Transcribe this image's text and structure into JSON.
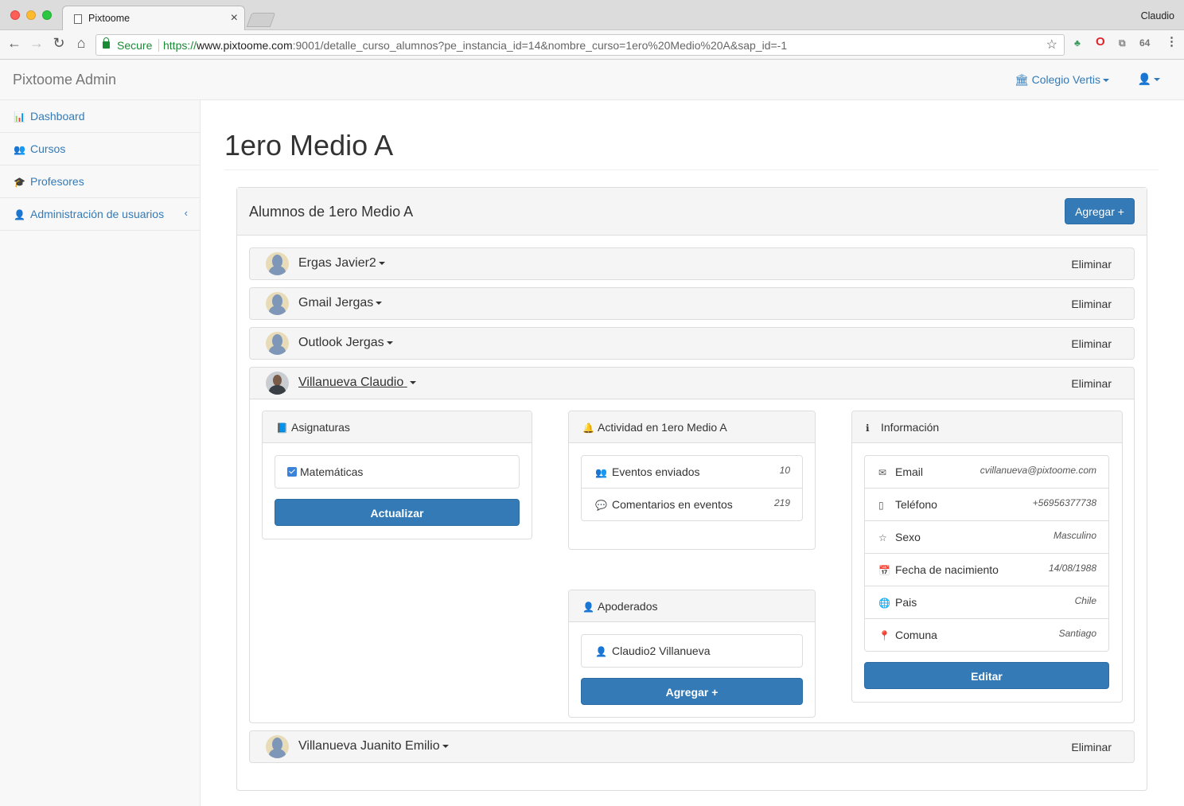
{
  "browser": {
    "tab_title": "Pixtoome",
    "user": "Claudio",
    "secure_label": "Secure",
    "url_scheme": "https://",
    "url_host": "www.pixtoome.com",
    "url_rest": ":9001/detalle_curso_alumnos?pe_instancia_id=14&nombre_curso=1ero%20Medio%20A&sap_id=-1",
    "extension_badge": "64"
  },
  "navbar": {
    "brand": "Pixtoome Admin",
    "school": "Colegio Vertis"
  },
  "sidebar": {
    "items": [
      {
        "label": "Dashboard",
        "icon": "bar-chart-icon"
      },
      {
        "label": "Cursos",
        "icon": "users-icon"
      },
      {
        "label": "Profesores",
        "icon": "graduation-cap-icon"
      },
      {
        "label": "Administración de usuarios",
        "icon": "user-icon"
      }
    ]
  },
  "page": {
    "title": "1ero Medio A",
    "panel_title": "Alumnos de 1ero Medio A",
    "add_button": "Agregar +"
  },
  "students": [
    {
      "name": "Ergas Javier2",
      "delete_label": "Eliminar"
    },
    {
      "name": "Gmail Jergas",
      "delete_label": "Eliminar"
    },
    {
      "name": "Outlook Jergas",
      "delete_label": "Eliminar"
    },
    {
      "name": "Villanueva Claudio",
      "delete_label": "Eliminar",
      "expanded": true
    },
    {
      "name": "Villanueva Juanito Emilio",
      "delete_label": "Eliminar"
    }
  ],
  "detail": {
    "asignaturas": {
      "title": "Asignaturas",
      "subjects": [
        {
          "label": "Matemáticas",
          "checked": true
        }
      ],
      "update_button": "Actualizar"
    },
    "actividad": {
      "title": "Actividad en 1ero Medio A",
      "items": [
        {
          "label": "Eventos enviados",
          "value": "10"
        },
        {
          "label": "Comentarios en eventos",
          "value": "219"
        }
      ]
    },
    "apoderados": {
      "title": "Apoderados",
      "items": [
        {
          "label": "Claudio2 Villanueva"
        }
      ],
      "add_button": "Agregar +"
    },
    "informacion": {
      "title": "Información",
      "rows": [
        {
          "label": "Email",
          "value": "cvillanueva@pixtoome.com"
        },
        {
          "label": "Teléfono",
          "value": "+56956377738"
        },
        {
          "label": "Sexo",
          "value": "Masculino"
        },
        {
          "label": "Fecha de nacimiento",
          "value": "14/08/1988"
        },
        {
          "label": "Pais",
          "value": "Chile"
        },
        {
          "label": "Comuna",
          "value": "Santiago"
        }
      ],
      "edit_button": "Editar"
    }
  },
  "colors": {
    "primary": "#337ab7",
    "link": "#337ab7",
    "panel_heading_bg": "#f5f5f5",
    "secure_green": "#1a8a34"
  }
}
